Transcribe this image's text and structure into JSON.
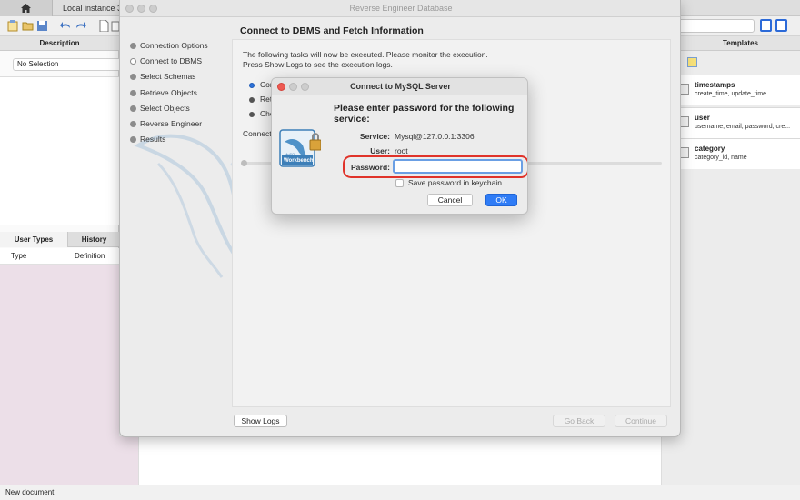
{
  "tabs": {
    "home": "home-icon",
    "instance": "Local instance 3"
  },
  "left_panel": {
    "description_header": "Description",
    "selection": "No Selection",
    "tab_user_types": "User Types",
    "tab_history": "History",
    "col_type": "Type",
    "col_definition": "Definition"
  },
  "right_panel": {
    "templates_header": "Templates",
    "templates": [
      {
        "name": "timestamps",
        "columns": "create_time, update_time"
      },
      {
        "name": "user",
        "columns": "username, email, password, cre..."
      },
      {
        "name": "category",
        "columns": "category_id, name"
      }
    ]
  },
  "status_bar": "New document.",
  "reverse_engineer": {
    "window_title": "Reverse Engineer Database",
    "steps": [
      {
        "label": "Connection Options",
        "state": "done"
      },
      {
        "label": "Connect to DBMS",
        "state": "active"
      },
      {
        "label": "Select Schemas",
        "state": "pending"
      },
      {
        "label": "Retrieve Objects",
        "state": "pending"
      },
      {
        "label": "Select Objects",
        "state": "pending"
      },
      {
        "label": "Reverse Engineer",
        "state": "pending"
      },
      {
        "label": "Results",
        "state": "pending"
      }
    ],
    "content_title": "Connect to DBMS and Fetch Information",
    "desc_line1": "The following tasks will now be executed. Please monitor the execution.",
    "desc_line2": "Press Show Logs to see the execution logs.",
    "tasks": [
      "Con",
      "Ret",
      "Che"
    ],
    "connect_text": "Connect",
    "show_logs": "Show Logs",
    "go_back": "Go Back",
    "continue": "Continue"
  },
  "password_dialog": {
    "title": "Connect to MySQL Server",
    "heading_line1": "Please enter password for the following",
    "heading_line2": "service:",
    "service_label": "Service:",
    "service_value": "Mysql@127.0.0.1:3306",
    "user_label": "User:",
    "user_value": "root",
    "password_label": "Password:",
    "password_value": "",
    "keychain_label": "Save password in keychain",
    "cancel": "Cancel",
    "ok": "OK"
  },
  "icon_text": {
    "mysql": "MySQL",
    "workbench": "Workbench"
  },
  "colors": {
    "accent_blue": "#2f7cf6",
    "highlight_red": "#e0332a",
    "close_red": "#ee5a52"
  }
}
